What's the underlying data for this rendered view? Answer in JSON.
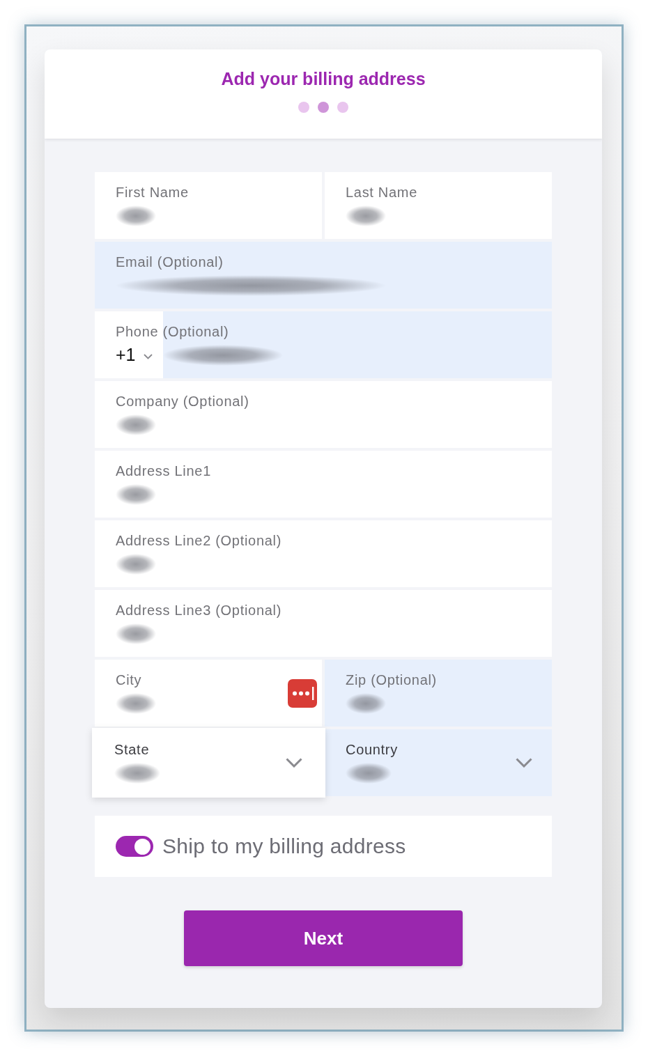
{
  "header": {
    "title": "Add your billing address",
    "steps": [
      {
        "selected": false
      },
      {
        "selected": true
      },
      {
        "selected": false
      }
    ]
  },
  "form": {
    "rows": [
      [
        {
          "kind": "text",
          "label": "First Name",
          "filled": true,
          "autofilled": false,
          "focused": false,
          "autofill_icon": false
        },
        {
          "kind": "text",
          "label": "Last Name",
          "filled": true,
          "autofilled": false,
          "focused": false,
          "autofill_icon": false
        }
      ],
      [
        {
          "kind": "email",
          "label": "Email (Optional)",
          "filled": true,
          "autofilled": true,
          "focused": false,
          "autofill_icon": false
        }
      ],
      [
        {
          "kind": "phone",
          "label": "Phone (Optional)",
          "code": "+1",
          "filled": true,
          "autofilled": true,
          "focused": false,
          "autofill_icon": false
        }
      ],
      [
        {
          "kind": "text",
          "label": "Company (Optional)",
          "filled": true,
          "autofilled": false,
          "focused": false,
          "autofill_icon": false
        }
      ],
      [
        {
          "kind": "text",
          "label": "Address Line1",
          "filled": true,
          "autofilled": false,
          "focused": false,
          "autofill_icon": false
        }
      ],
      [
        {
          "kind": "text",
          "label": "Address Line2 (Optional)",
          "filled": true,
          "autofilled": false,
          "focused": false,
          "autofill_icon": false
        }
      ],
      [
        {
          "kind": "text",
          "label": "Address Line3 (Optional)",
          "filled": true,
          "autofilled": false,
          "focused": false,
          "autofill_icon": false
        }
      ],
      [
        {
          "kind": "text",
          "label": "City",
          "filled": true,
          "autofilled": false,
          "focused": false,
          "autofill_icon": true
        },
        {
          "kind": "text",
          "label": "Zip (Optional)",
          "filled": true,
          "autofilled": true,
          "focused": false,
          "autofill_icon": false
        }
      ],
      [
        {
          "kind": "select",
          "label": "State",
          "filled": true,
          "autofilled": false,
          "focused": true,
          "autofill_icon": false
        },
        {
          "kind": "select",
          "label": "Country",
          "filled": true,
          "autofilled": true,
          "focused": false,
          "autofill_icon": false
        }
      ]
    ]
  },
  "shipping_toggle": {
    "label": "Ship to my billing address",
    "on": true
  },
  "next_button": {
    "label": "Next"
  }
}
